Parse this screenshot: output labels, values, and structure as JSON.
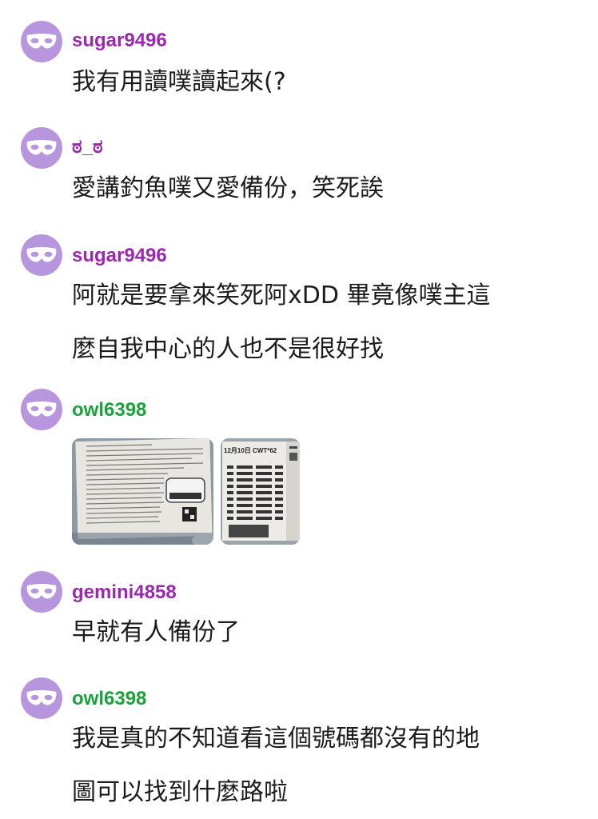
{
  "colors": {
    "avatar_bg": "#b896de",
    "purple_user": "#9c27b0",
    "green_user": "#1aa33a",
    "text": "#1c1c1c"
  },
  "avatar_icon": "mask-icon",
  "comments": [
    {
      "username": "sugar9496",
      "name_color": "purple",
      "lines": [
        "我有用讀噗讀起來(?"
      ]
    },
    {
      "username": "ಠ_ಠ",
      "name_color": "purple",
      "lines": [
        "愛講釣魚噗又愛備份，笑死誒"
      ]
    },
    {
      "username": "sugar9496",
      "name_color": "purple",
      "lines": [
        "阿就是要拿來笑死阿xDD 畢竟像噗主這",
        "麼自我中心的人也不是很好找"
      ]
    },
    {
      "username": "owl6398",
      "name_color": "green",
      "lines": [],
      "images": [
        {
          "name": "flyer-photo",
          "caption": ""
        },
        {
          "name": "booklet-photo",
          "caption": "12月10日 CWT*62"
        }
      ]
    },
    {
      "username": "gemini4858",
      "name_color": "purple",
      "lines": [
        "早就有人備份了"
      ]
    },
    {
      "username": "owl6398",
      "name_color": "green",
      "lines": [
        "我是真的不知道看這個號碼都沒有的地",
        "圖可以找到什麼路啦"
      ]
    }
  ]
}
